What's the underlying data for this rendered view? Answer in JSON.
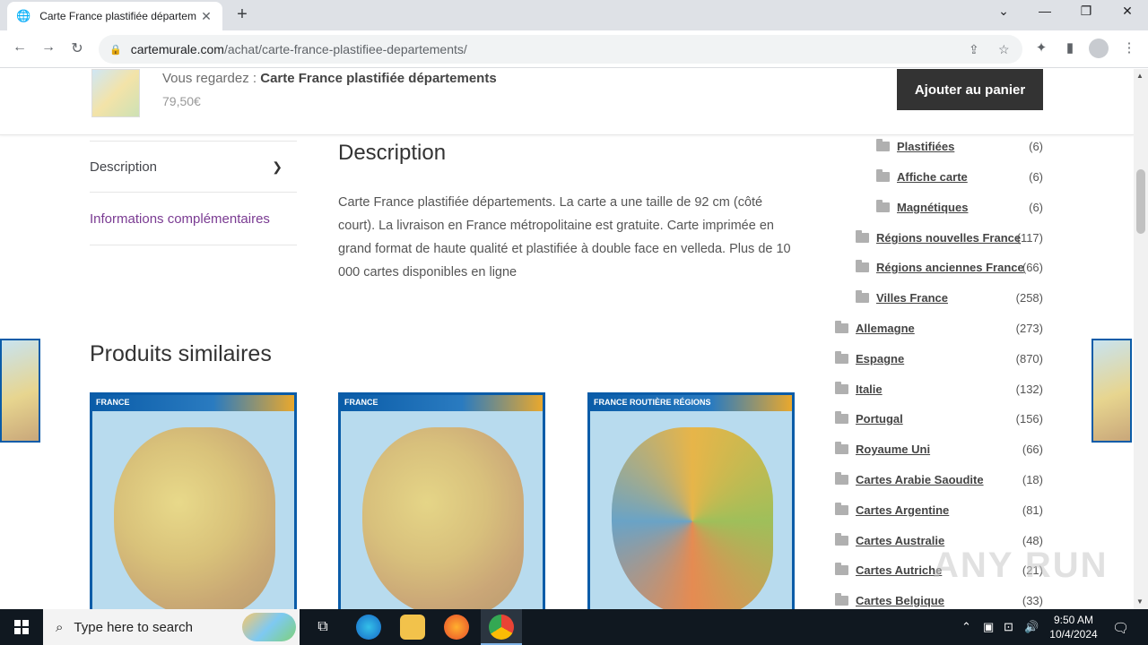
{
  "browser": {
    "tab_title": "Carte France plastifiée départem",
    "url_host": "cartemurale.com",
    "url_path": "/achat/carte-france-plastifiee-departements/"
  },
  "sticky": {
    "viewing_prefix": "Vous regardez : ",
    "viewing_product": "Carte France plastifiée départements",
    "price": "79,50€",
    "add_to_cart": "Ajouter au panier"
  },
  "tabs": {
    "description": "Description",
    "additional": "Informations complémentaires"
  },
  "description": {
    "title": "Description",
    "text": "Carte France plastifiée départements. La carte a une taille de 92 cm (côté court). La livraison en France métropolitaine est gratuite. Carte imprimée en grand format de haute qualité et plastifiée à double face en velleda. Plus de 10 000 cartes disponibles en ligne"
  },
  "similar": {
    "title": "Produits similaires",
    "products": [
      {
        "header": "FRANCE"
      },
      {
        "header": "FRANCE"
      },
      {
        "header": "FRANCE ROUTIÈRE RÉGIONS"
      }
    ]
  },
  "categories": [
    {
      "name": "Plastifiées",
      "count": "(6)"
    },
    {
      "name": "Affiche carte",
      "count": "(6)"
    },
    {
      "name": "Magnétiques",
      "count": "(6)"
    },
    {
      "name": "Régions nouvelles France",
      "count": "(117)"
    },
    {
      "name": "Régions anciennes France",
      "count": "(66)"
    },
    {
      "name": "Villes France",
      "count": "(258)"
    },
    {
      "name": "Allemagne",
      "count": "(273)"
    },
    {
      "name": "Espagne",
      "count": "(870)"
    },
    {
      "name": "Italie",
      "count": "(132)"
    },
    {
      "name": "Portugal",
      "count": "(156)"
    },
    {
      "name": "Royaume Uni",
      "count": "(66)"
    },
    {
      "name": "Cartes Arabie Saoudite",
      "count": "(18)"
    },
    {
      "name": "Cartes Argentine",
      "count": "(81)"
    },
    {
      "name": "Cartes Australie",
      "count": "(48)"
    },
    {
      "name": "Cartes Autriche",
      "count": "(21)"
    },
    {
      "name": "Cartes Belgique",
      "count": "(33)"
    }
  ],
  "watermark": "ANY RUN",
  "taskbar": {
    "search_placeholder": "Type here to search",
    "time": "9:50 AM",
    "date": "10/4/2024"
  }
}
